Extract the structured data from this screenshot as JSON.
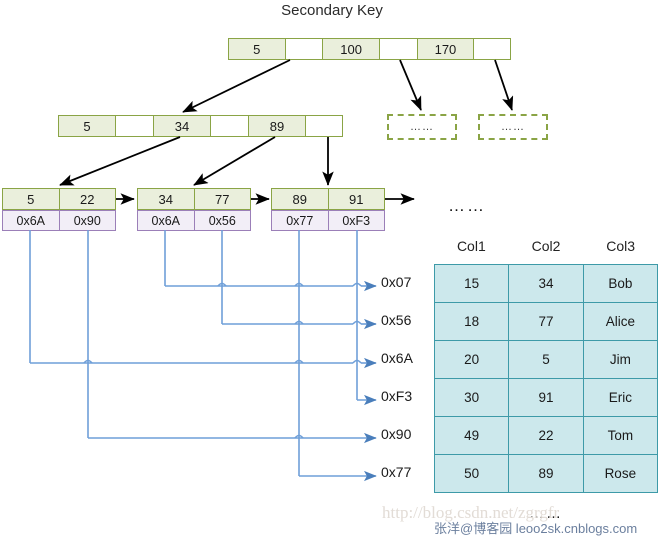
{
  "title": "Secondary Key",
  "root_node": {
    "name": "root-index-node",
    "cells": [
      {
        "type": "key",
        "text": "5"
      },
      {
        "type": "pointer",
        "text": ""
      },
      {
        "type": "key",
        "text": "100"
      },
      {
        "type": "pointer",
        "text": ""
      },
      {
        "type": "key",
        "text": "170"
      },
      {
        "type": "pointer",
        "text": ""
      }
    ]
  },
  "level2_node": {
    "name": "internal-index-node",
    "cells": [
      {
        "type": "key",
        "text": "5"
      },
      {
        "type": "pointer",
        "text": ""
      },
      {
        "type": "key",
        "text": "34"
      },
      {
        "type": "pointer",
        "text": ""
      },
      {
        "type": "key",
        "text": "89"
      },
      {
        "type": "pointer",
        "text": ""
      }
    ]
  },
  "placeholder_nodes": [
    {
      "text": "……"
    },
    {
      "text": "……"
    }
  ],
  "leaf_nodes": [
    {
      "keys": [
        "5",
        "22"
      ],
      "pointers": [
        "0x6A",
        "0x90"
      ]
    },
    {
      "keys": [
        "34",
        "77"
      ],
      "pointers": [
        "0x6A",
        "0x56"
      ]
    },
    {
      "keys": [
        "89",
        "91"
      ],
      "pointers": [
        "0x77",
        "0xF3"
      ]
    }
  ],
  "leaf_trailing_dots": "……",
  "address_labels": [
    "0x07",
    "0x56",
    "0x6A",
    "0xF3",
    "0x90",
    "0x77"
  ],
  "table": {
    "headers": [
      "Col1",
      "Col2",
      "Col3"
    ],
    "rows": [
      [
        "15",
        "34",
        "Bob"
      ],
      [
        "18",
        "77",
        "Alice"
      ],
      [
        "20",
        "5",
        "Jim"
      ],
      [
        "30",
        "91",
        "Eric"
      ],
      [
        "49",
        "22",
        "Tom"
      ],
      [
        "50",
        "89",
        "Rose"
      ]
    ],
    "trailing_dots": "……"
  },
  "watermarks": {
    "url": "http://blog.csdn.net/zgrgfr",
    "author": "张洋@博客园 leoo2sk.cnblogs.com"
  },
  "colors": {
    "index_fill": "#eaefdc",
    "index_border": "#8aa445",
    "leaf_pointer_fill": "#f2eef7",
    "leaf_pointer_border": "#9b7fb8",
    "table_fill": "#cce8ec",
    "table_border": "#3d9aa8",
    "connector": "#6f9fd8"
  }
}
